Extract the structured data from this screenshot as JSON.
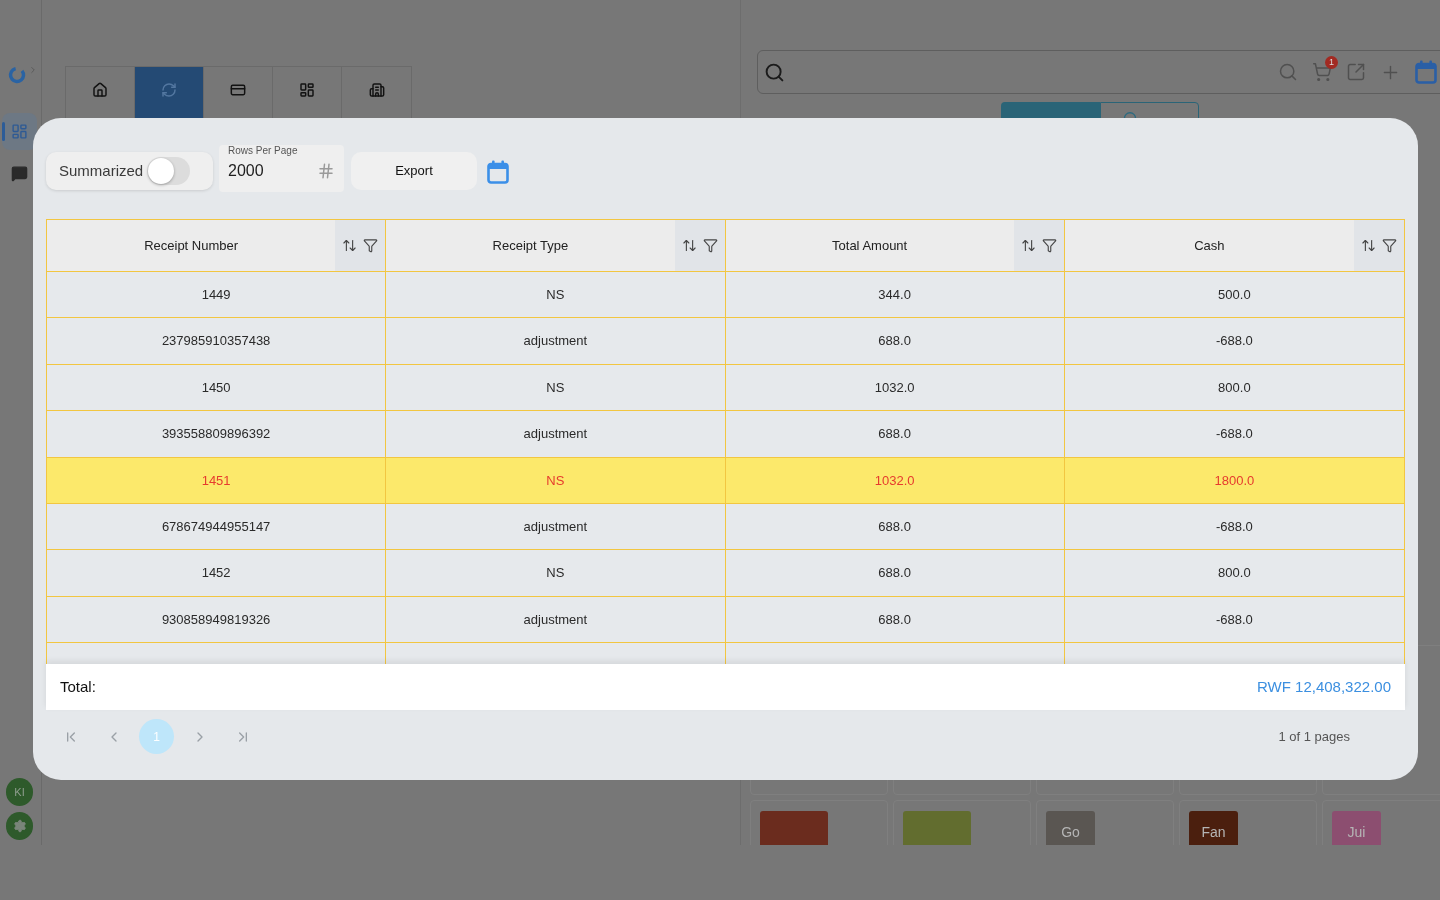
{
  "sidebar": {
    "items": [
      {
        "kind": "dashboard",
        "selected": true
      },
      {
        "kind": "chat",
        "selected": false
      }
    ],
    "avatar": "KI"
  },
  "nav_tabs": [
    {
      "selected": false
    },
    {
      "selected": true
    },
    {
      "selected": false
    },
    {
      "selected": false
    },
    {
      "selected": false
    }
  ],
  "search_bar": {
    "cart_badge": "1"
  },
  "view_tabs": [
    {
      "selected": true
    },
    {
      "selected": false
    }
  ],
  "product_tiles": [
    {
      "kind": "image",
      "color": "#6b2c1e"
    },
    {
      "kind": "image",
      "color": "#626d2f"
    },
    {
      "kind": "letter",
      "label": "Go",
      "color": "#5a5652"
    },
    {
      "kind": "letter",
      "label": "Fan",
      "color": "#4b1f0e"
    },
    {
      "kind": "letter",
      "label": "Jui",
      "color": "#8c4e70"
    }
  ],
  "dialog": {
    "summarized": {
      "label": "Summarized",
      "on": false
    },
    "rows_per_page": {
      "label": "Rows Per Page",
      "value": "2000"
    },
    "export_button": "Export",
    "table": {
      "columns": [
        "Receipt Number",
        "Receipt Type",
        "Total Amount",
        "Cash"
      ],
      "rows": [
        {
          "cells": [
            "1449",
            "NS",
            "344.0",
            "500.0"
          ],
          "selected": false
        },
        {
          "cells": [
            "237985910357438",
            "adjustment",
            "688.0",
            "-688.0"
          ],
          "selected": false
        },
        {
          "cells": [
            "1450",
            "NS",
            "1032.0",
            "800.0"
          ],
          "selected": false
        },
        {
          "cells": [
            "393558809896392",
            "adjustment",
            "688.0",
            "-688.0"
          ],
          "selected": false
        },
        {
          "cells": [
            "1451",
            "NS",
            "1032.0",
            "1800.0"
          ],
          "selected": true
        },
        {
          "cells": [
            "678674944955147",
            "adjustment",
            "688.0",
            "-688.0"
          ],
          "selected": false
        },
        {
          "cells": [
            "1452",
            "NS",
            "688.0",
            "800.0"
          ],
          "selected": false
        },
        {
          "cells": [
            "930858949819326",
            "adjustment",
            "688.0",
            "-688.0"
          ],
          "selected": false
        }
      ]
    },
    "total": {
      "label": "Total:",
      "value": "RWF 12,408,322.00"
    },
    "pagination": {
      "pages": [
        {
          "label": "1",
          "selected": true
        }
      ],
      "summary": "1 of 1 pages"
    }
  }
}
